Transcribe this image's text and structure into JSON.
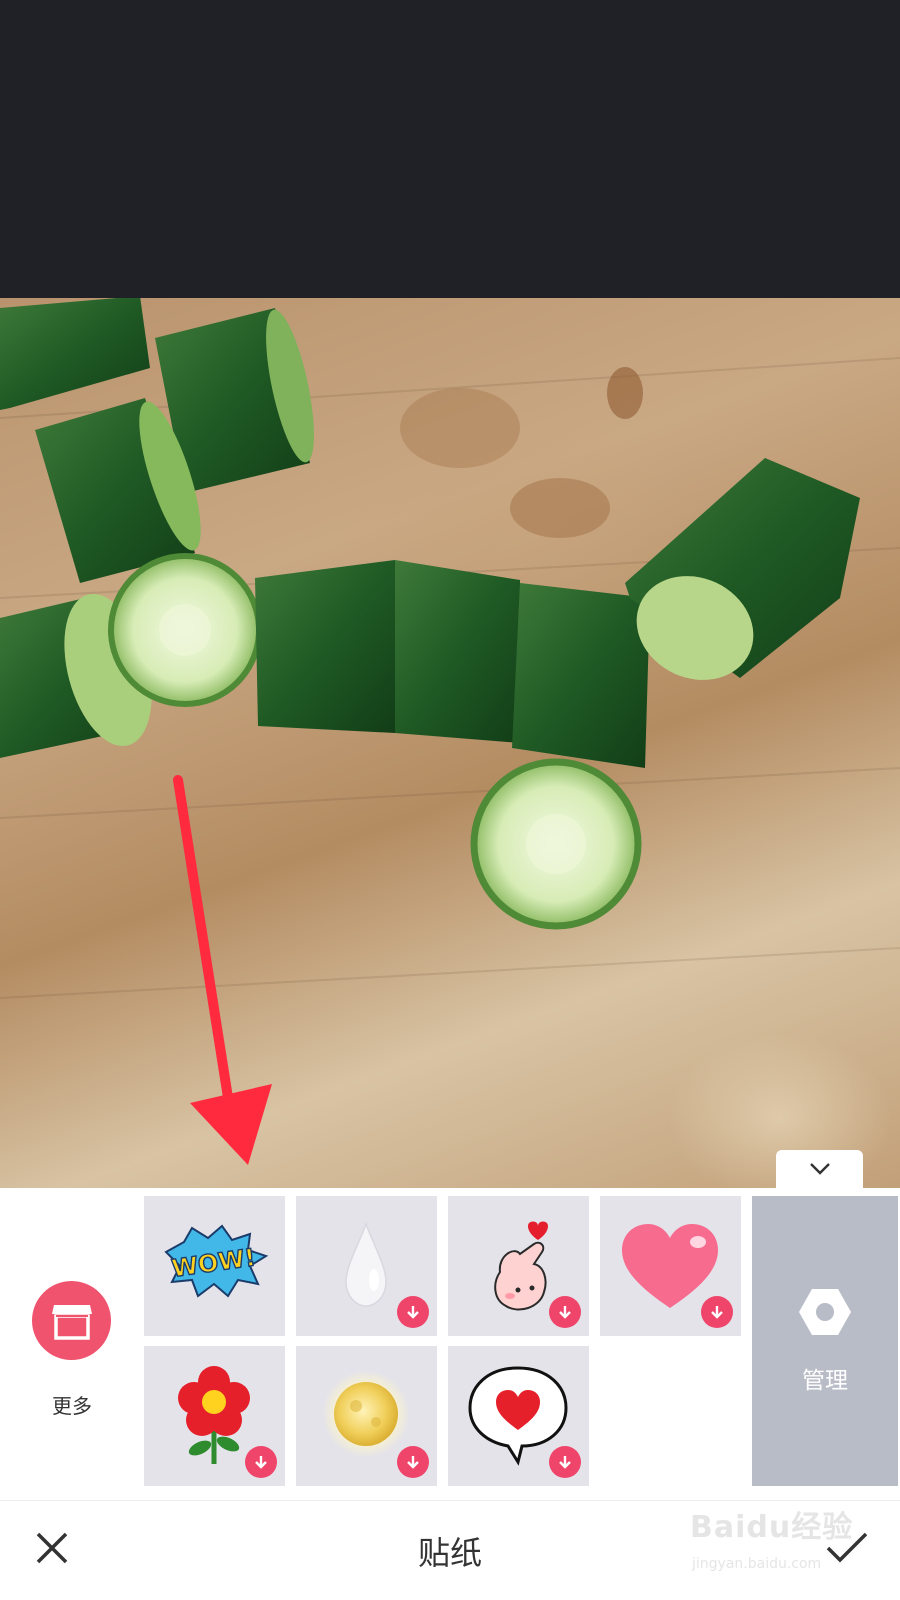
{
  "editor": {
    "title": "贴纸",
    "more_label": "更多",
    "manage_label": "管理",
    "close_icon": "close-icon",
    "confirm_icon": "check-icon",
    "collapse_icon": "chevron-down-icon"
  },
  "stickers": [
    {
      "name": "wow",
      "text": "WOW!",
      "downloaded": true
    },
    {
      "name": "water-drop",
      "downloaded": false
    },
    {
      "name": "finger-heart",
      "downloaded": false
    },
    {
      "name": "pink-heart",
      "downloaded": false
    },
    {
      "name": "red-flower",
      "downloaded": false
    },
    {
      "name": "full-moon",
      "downloaded": false
    },
    {
      "name": "heart-speech-bubble",
      "downloaded": false
    }
  ],
  "watermark": {
    "brand": "Baidu经验",
    "url": "jingyan.baidu.com"
  },
  "colors": {
    "accent": "#f0456a",
    "arrow": "#ff2a3e",
    "dark_bg": "#202126",
    "manage_bg": "#b8bcc7"
  }
}
